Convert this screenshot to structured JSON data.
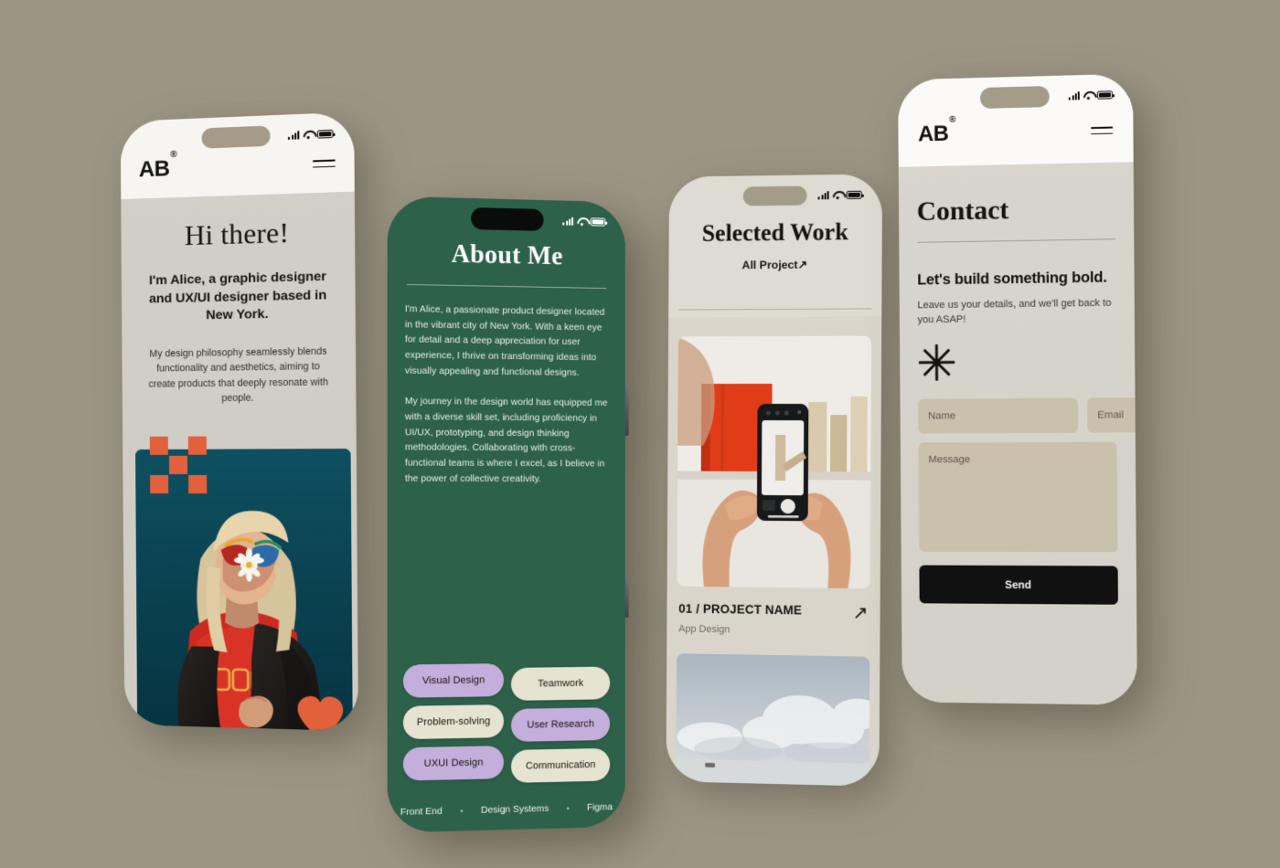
{
  "background_color": "#9c9584",
  "brand": {
    "logo": "AB",
    "trademark": "®"
  },
  "colors": {
    "background": "#9c9584",
    "green_screen": "#2d6149",
    "tag_purple": "#c4aedb",
    "tag_cream": "#e7e3d2",
    "accent_orange": "#e3603c",
    "photo_teal": "#0a4050",
    "field_fill": "#c9c1ac",
    "send_button": "#111111"
  },
  "phones": [
    {
      "id": "hero",
      "status_bar": {
        "signal": "signal-bars-icon",
        "wifi": "wifi-icon",
        "battery": "battery-icon"
      },
      "topbar": {
        "logo": "AB",
        "trademark": "®",
        "menu": "hamburger-menu-icon"
      },
      "heading": "Hi there!",
      "lead": "I'm Alice, a graphic designer and UX/UI designer based in New York.",
      "paragraph": "My design philosophy seamlessly blends functionality and aesthetics, aiming to create products that deeply resonate with people.",
      "decorations": [
        "pixel-cross-shape",
        "heart-shape"
      ],
      "photo_alt": "portrait-photo"
    },
    {
      "id": "about",
      "status_bar": {
        "signal": "signal-bars-icon",
        "wifi": "wifi-icon",
        "battery": "battery-icon"
      },
      "heading": "About Me",
      "paragraphs": [
        "I'm Alice, a passionate product designer located in the vibrant city of New York. With a keen eye for detail and a deep appreciation for user experience, I thrive on transforming ideas into visually appealing and functional designs.",
        "My journey in the design world has equipped me with a diverse skill set, including proficiency in UI/UX, prototyping, and design thinking methodologies. Collaborating with cross-functional teams is where I excel, as I believe in the power of collective creativity."
      ],
      "tags": [
        {
          "label": "Visual Design",
          "style": "purple"
        },
        {
          "label": "Teamwork",
          "style": "cream"
        },
        {
          "label": "Problem-solving",
          "style": "cream"
        },
        {
          "label": "User Research",
          "style": "purple"
        },
        {
          "label": "UXUI Design",
          "style": "purple"
        },
        {
          "label": "Communication",
          "style": "cream"
        }
      ],
      "ticker": [
        "Front End",
        "Design Systems",
        "Figma"
      ],
      "ticker_separator": "•"
    },
    {
      "id": "work",
      "status_bar": {
        "signal": "signal-bars-icon",
        "wifi": "wifi-icon",
        "battery": "battery-icon"
      },
      "heading": "Selected Work",
      "all_projects_label": "All Project",
      "all_projects_arrow": "↗",
      "project": {
        "name": "01 / PROJECT NAME",
        "category": "App Design",
        "arrow": "↗"
      },
      "image_one_alt": "hands-holding-phone-photo",
      "image_two_alt": "cloudy-sky-photo"
    },
    {
      "id": "contact",
      "status_bar": {
        "signal": "signal-bars-icon",
        "wifi": "wifi-icon",
        "battery": "battery-icon"
      },
      "topbar": {
        "logo": "AB",
        "trademark": "®",
        "menu": "hamburger-menu-icon"
      },
      "heading": "Contact",
      "tagline": "Let's build something bold.",
      "subtext": "Leave us your details, and we'll get back to you ASAP!",
      "decoration": "asterisk-icon",
      "form": {
        "name_placeholder": "Name",
        "name_value": "",
        "email_placeholder": "Email",
        "email_value": "",
        "message_placeholder": "Message",
        "message_value": "",
        "submit_label": "Send"
      }
    }
  ]
}
